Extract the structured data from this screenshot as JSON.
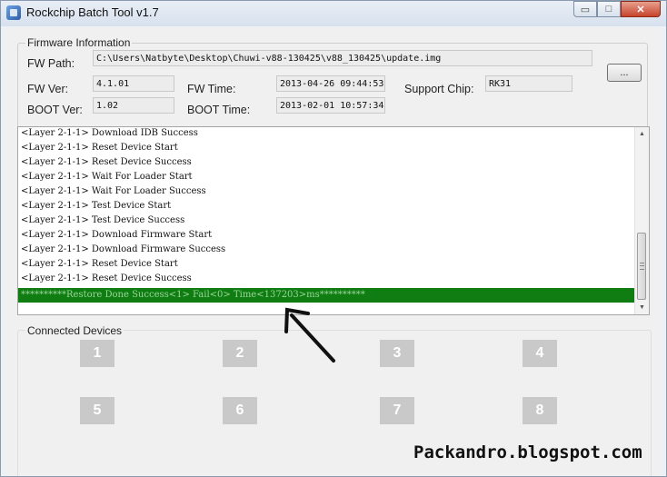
{
  "window": {
    "title": "Rockchip Batch Tool v1.7",
    "minimize": "▭",
    "maximize": "□",
    "close": "✕"
  },
  "firmware": {
    "group_label": "Firmware Information",
    "fw_path_label": "FW Path:",
    "fw_path_value": "C:\\Users\\Natbyte\\Desktop\\Chuwi-v88-130425\\v88_130425\\update.img",
    "browse_label": "...",
    "fw_ver_label": "FW Ver:",
    "fw_ver_value": "4.1.01",
    "fw_time_label": "FW Time:",
    "fw_time_value": "2013-04-26 09:44:53",
    "support_chip_label": "Support Chip:",
    "support_chip_value": "RK31",
    "boot_ver_label": "BOOT Ver:",
    "boot_ver_value": "1.02",
    "boot_time_label": "BOOT Time:",
    "boot_time_value": "2013-02-01 10:57:34"
  },
  "log": {
    "lines": [
      "<Layer 2-1-1> Download IDB Success",
      "<Layer 2-1-1> Reset Device Start",
      "<Layer 2-1-1> Reset Device Success",
      "<Layer 2-1-1> Wait For Loader Start",
      "<Layer 2-1-1> Wait For Loader Success",
      "<Layer 2-1-1> Test Device Start",
      "<Layer 2-1-1> Test Device Success",
      "<Layer 2-1-1> Download Firmware Start",
      "<Layer 2-1-1> Download Firmware Success",
      "<Layer 2-1-1> Reset Device Start",
      "<Layer 2-1-1> Reset Device Success"
    ],
    "highlight": "**********Restore Done Success<1> Fail<0> Time<137203>ms**********",
    "highlight_color": "#0f7d12",
    "scroll_up": "▲",
    "scroll_down": "▼"
  },
  "devices": {
    "group_label": "Connected Devices",
    "slots": [
      "1",
      "2",
      "3",
      "4",
      "5",
      "6",
      "7",
      "8"
    ]
  },
  "watermark": "Packandro.blogspot.com"
}
